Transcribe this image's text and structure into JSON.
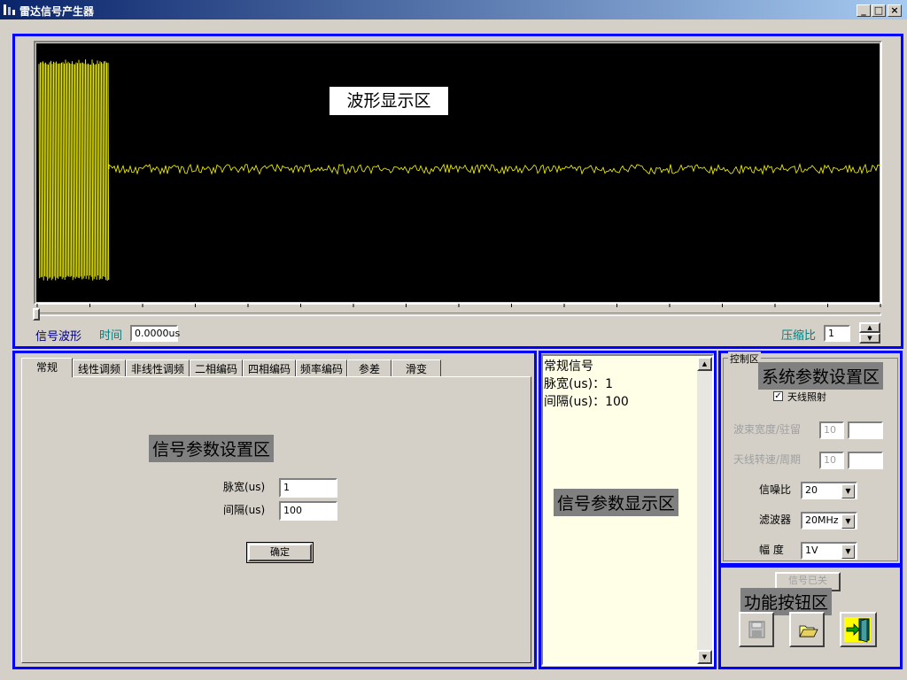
{
  "window": {
    "title": "雷达信号产生器",
    "min_label": "_",
    "max_label": "□",
    "close_label": "×"
  },
  "waveform": {
    "region_label": "波形显示区",
    "signal_label": "信号波形",
    "time_label": "时间",
    "time_value": "0.0000us",
    "compress_label": "压缩比",
    "compress_value": "1",
    "trace_color": "#ffff00"
  },
  "signal_settings": {
    "tabs": [
      "常规",
      "线性调频",
      "非线性调频",
      "二相编码",
      "四相编码",
      "频率编码",
      "参差",
      "滑变"
    ],
    "active_tab": "常规",
    "region_label": "信号参数设置区",
    "pulse_width_label": "脉宽(us)",
    "pulse_width_value": "1",
    "interval_label": "间隔(us)",
    "interval_value": "100",
    "confirm_label": "确定"
  },
  "signal_display": {
    "lines": [
      "常规信号",
      "脉宽(us)：1",
      "间隔(us)：100"
    ],
    "region_label": "信号参数显示区"
  },
  "system_settings": {
    "group_label": "控制区",
    "region_label": "系统参数设置区",
    "antenna_checkbox_label": "天线照射",
    "beam_label": "波束宽度/驻留",
    "beam_value": "10",
    "rotation_label": "天线转速/周期",
    "rotation_value": "10",
    "snr_label": "信噪比",
    "snr_value": "20",
    "filter_label": "滤波器",
    "filter_value": "20MHz",
    "amplitude_label": "幅 度",
    "amplitude_value": "1V"
  },
  "function_buttons": {
    "region_label": "功能按钮区",
    "top_button_label": "信号已关"
  }
}
